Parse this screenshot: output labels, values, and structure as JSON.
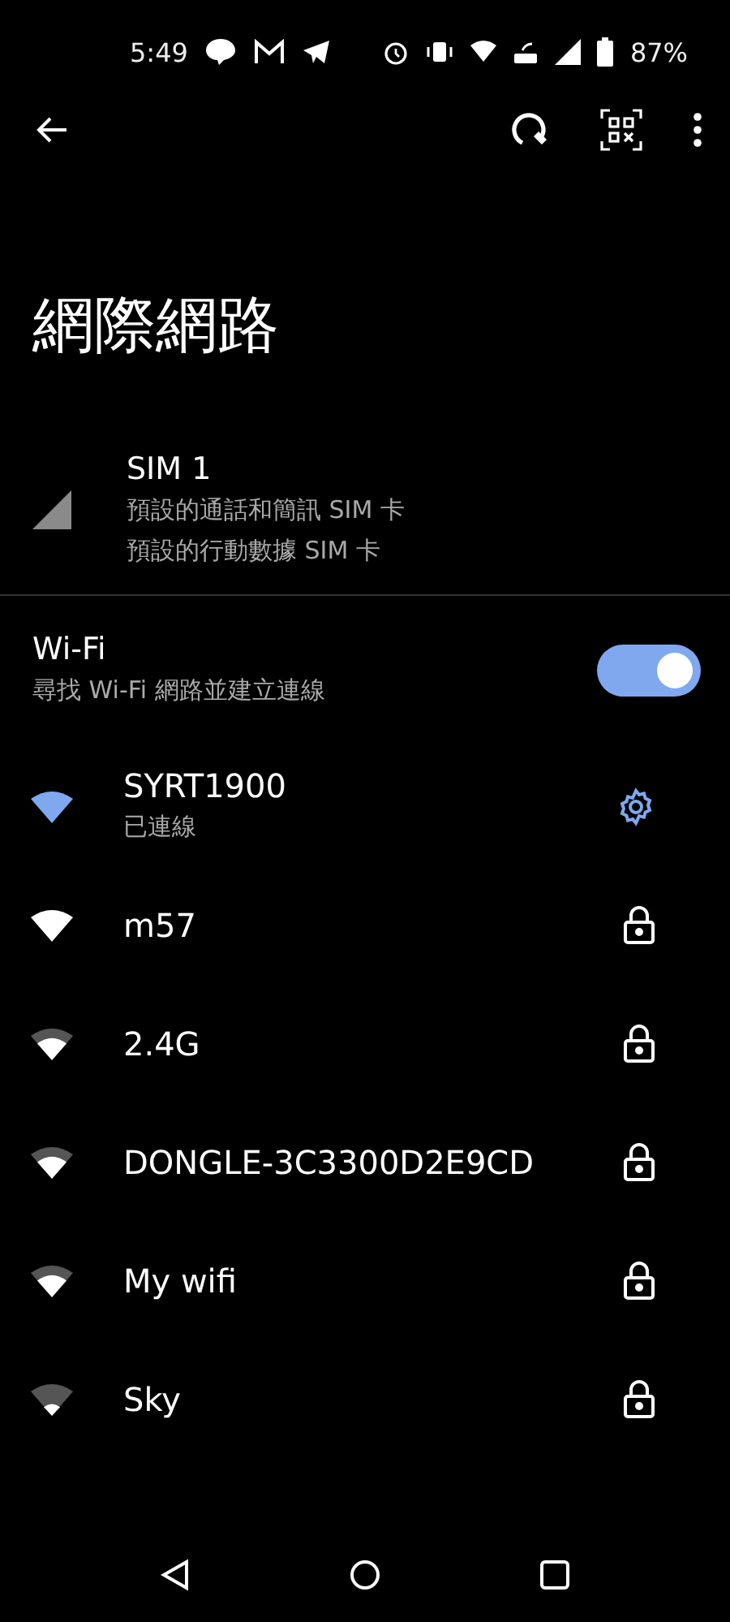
{
  "status_bar": {
    "time": "5:49",
    "battery": "87%"
  },
  "title": "網際網路",
  "sim": {
    "name": "SIM 1",
    "lines": [
      "預設的通話和簡訊 SIM 卡",
      "預設的行動數據 SIM 卡"
    ]
  },
  "wifi": {
    "label": "Wi-Fi",
    "description": "尋找 Wi-Fi 網路並建立連線",
    "on": true
  },
  "networks": [
    {
      "name": "SYRT1900",
      "status": "已連線",
      "connected": true,
      "kind": "strong"
    },
    {
      "name": "m57",
      "connected": false,
      "kind": "strong"
    },
    {
      "name": "2.4G",
      "connected": false,
      "kind": "medium"
    },
    {
      "name": "DONGLE-3C3300D2E9CD",
      "connected": false,
      "kind": "medium"
    },
    {
      "name": "My wifi",
      "connected": false,
      "kind": "medium"
    },
    {
      "name": "Sky",
      "connected": false,
      "kind": "weak"
    }
  ]
}
